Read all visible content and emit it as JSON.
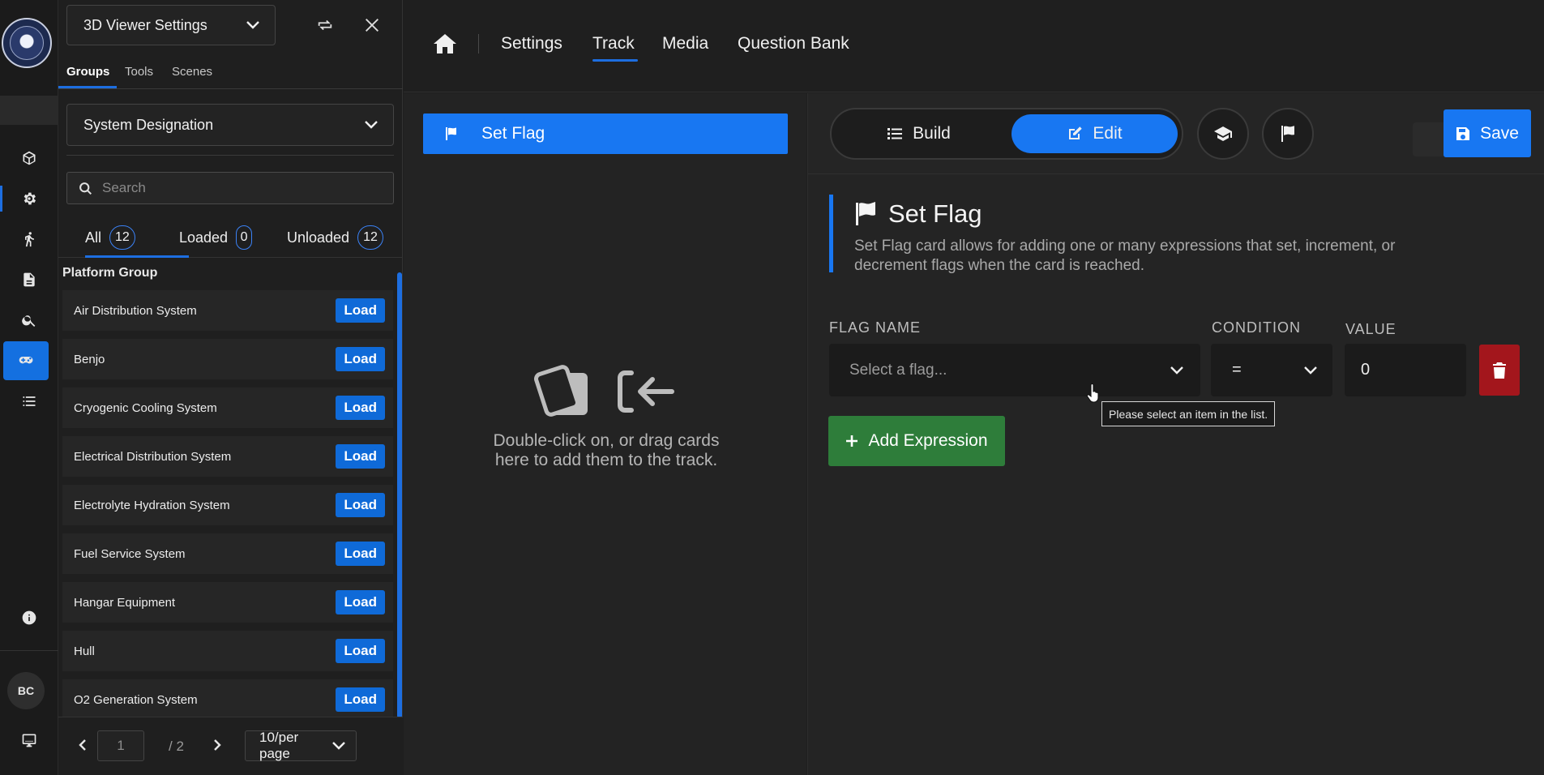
{
  "rail": {
    "avatar_initials": "BC",
    "items": [
      "cube-icon",
      "gear-icon",
      "walking-figure-icon",
      "document-icon",
      "search-icon",
      "gamepad-icon",
      "list-icon",
      "info-icon",
      "monitor-icon"
    ],
    "active_item": "gamepad-icon"
  },
  "panel": {
    "viewer_select": "3D Viewer Settings",
    "tabs": [
      "Groups",
      "Tools",
      "Scenes"
    ],
    "active_tab": "Groups",
    "group_select": "System Designation",
    "search_placeholder": "Search",
    "filters": [
      {
        "label": "All",
        "count": "12"
      },
      {
        "label": "Loaded",
        "count": "0"
      },
      {
        "label": "Unloaded",
        "count": "12"
      }
    ],
    "active_filter": "All",
    "group_label": "Platform Group",
    "items": [
      {
        "label": "Air Distribution System",
        "action": "Load"
      },
      {
        "label": "Benjo",
        "action": "Load"
      },
      {
        "label": "Cryogenic Cooling System",
        "action": "Load"
      },
      {
        "label": "Electrical Distribution System",
        "action": "Load"
      },
      {
        "label": "Electrolyte Hydration System",
        "action": "Load"
      },
      {
        "label": "Fuel Service System",
        "action": "Load"
      },
      {
        "label": "Hangar Equipment",
        "action": "Load"
      },
      {
        "label": "Hull",
        "action": "Load"
      },
      {
        "label": "O2 Generation System",
        "action": "Load"
      }
    ],
    "pager": {
      "page": "1",
      "total": "/ 2",
      "page_size": "10/per page"
    }
  },
  "topnav": {
    "links": [
      "Settings",
      "Track",
      "Media",
      "Question Bank"
    ],
    "active_link": "Track"
  },
  "track": {
    "card_label": "Set Flag",
    "drop_hint": "Double-click on, or drag cards here to add them to the track."
  },
  "editor": {
    "modes": [
      "Build",
      "Edit"
    ],
    "active_mode": "Edit",
    "save_label": "Save",
    "card_title": "Set Flag",
    "card_description": "Set Flag card allows for adding one or many expressions that set, increment, or decrement flags when the card is reached.",
    "labels": {
      "flag_name": "FLAG NAME",
      "condition": "CONDITION",
      "value": "VALUE"
    },
    "flag_placeholder": "Select a flag...",
    "condition_value": "=",
    "value": "0",
    "add_expression": "Add Expression",
    "tooltip": "Please select an item in the list."
  },
  "colors": {
    "accent": "#1877f2",
    "success": "#2e7d3a",
    "danger": "#a3161c",
    "background": "#1f1f1f"
  }
}
